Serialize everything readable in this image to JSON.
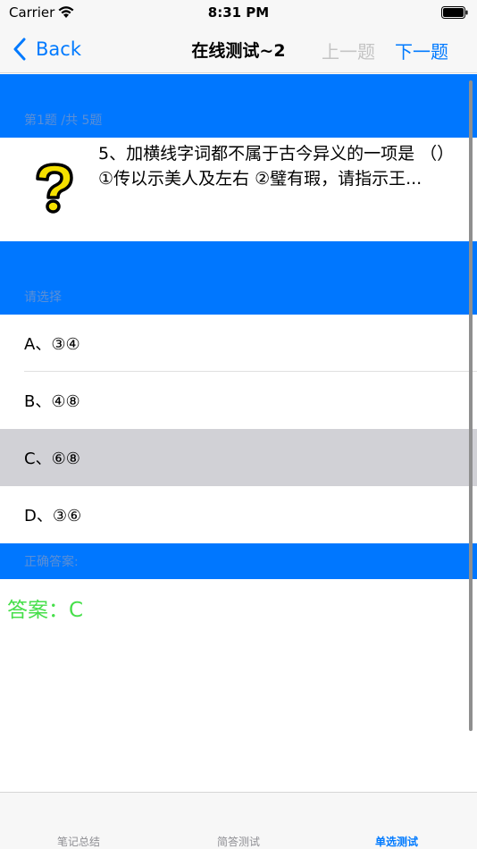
{
  "status_bar": {
    "carrier": "Carrier",
    "time": "8:31 PM"
  },
  "nav": {
    "back_label": "Back",
    "title": "在线测试~2",
    "prev_label": "上一题",
    "next_label": "下一题"
  },
  "question": {
    "progress_label": "第1题 /共 5题",
    "icon": "question-mark-icon",
    "text": "5、加横线字词都不属于古今异义的一项是 （）\n①传以示美人及左右 ②璧有瑕，请指示王..."
  },
  "options_section": {
    "label": "请选择",
    "options": [
      {
        "label": "A、③④"
      },
      {
        "label": "B、④⑧"
      },
      {
        "label": "C、⑥⑧"
      },
      {
        "label": "D、③⑥"
      }
    ],
    "selected_index": 2
  },
  "answer_section": {
    "label": "正确答案:",
    "answer": "答案：C"
  },
  "tab_bar": {
    "tabs": [
      {
        "label": "笔记总结"
      },
      {
        "label": "简答测试"
      },
      {
        "label": "单选测试"
      }
    ],
    "active_index": 2
  },
  "colors": {
    "accent": "#007aff",
    "section_header": "#0077ff",
    "answer_green": "#46df4a",
    "selected_row": "#d1d1d6"
  }
}
